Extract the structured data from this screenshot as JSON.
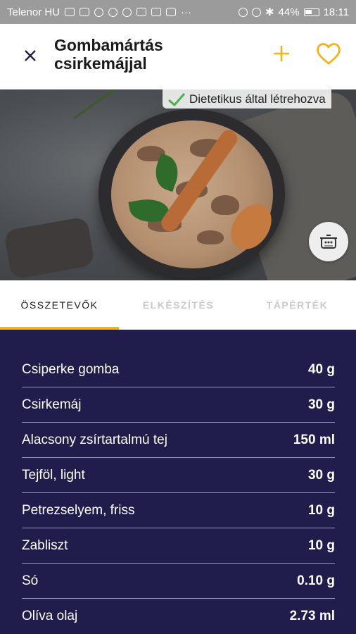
{
  "status_bar": {
    "carrier": "Telenor HU",
    "battery": "44%",
    "time": "18:11"
  },
  "header": {
    "title": "Gombamártás csirkemájjal",
    "close_icon": "close-icon",
    "add_icon": "plus-icon",
    "favorite_icon": "heart-outline-icon"
  },
  "hero": {
    "badge_text": "Dietetikus által létrehozva",
    "badge_icon": "checkmark-icon",
    "action_icon": "pot-icon"
  },
  "tabs": [
    {
      "label": "ÖSSZETEVŐK",
      "active": true
    },
    {
      "label": "ELKÉSZÍTÉS",
      "active": false
    },
    {
      "label": "TÁPÉRTÉK",
      "active": false
    }
  ],
  "ingredients": [
    {
      "name": "Csiperke gomba",
      "amount": "40 g"
    },
    {
      "name": "Csirkemáj",
      "amount": "30 g"
    },
    {
      "name": "Alacsony zsírtartalmú tej",
      "amount": "150 ml"
    },
    {
      "name": "Tejföl, light",
      "amount": "30 g"
    },
    {
      "name": "Petrezselyem, friss",
      "amount": "10 g"
    },
    {
      "name": "Zabliszt",
      "amount": "10 g"
    },
    {
      "name": "Só",
      "amount": "0.10 g"
    },
    {
      "name": "Olíva olaj",
      "amount": "2.73 ml"
    }
  ],
  "colors": {
    "accent": "#f2b21b",
    "list_background": "#201c4c",
    "header_background": "#ffffff"
  }
}
